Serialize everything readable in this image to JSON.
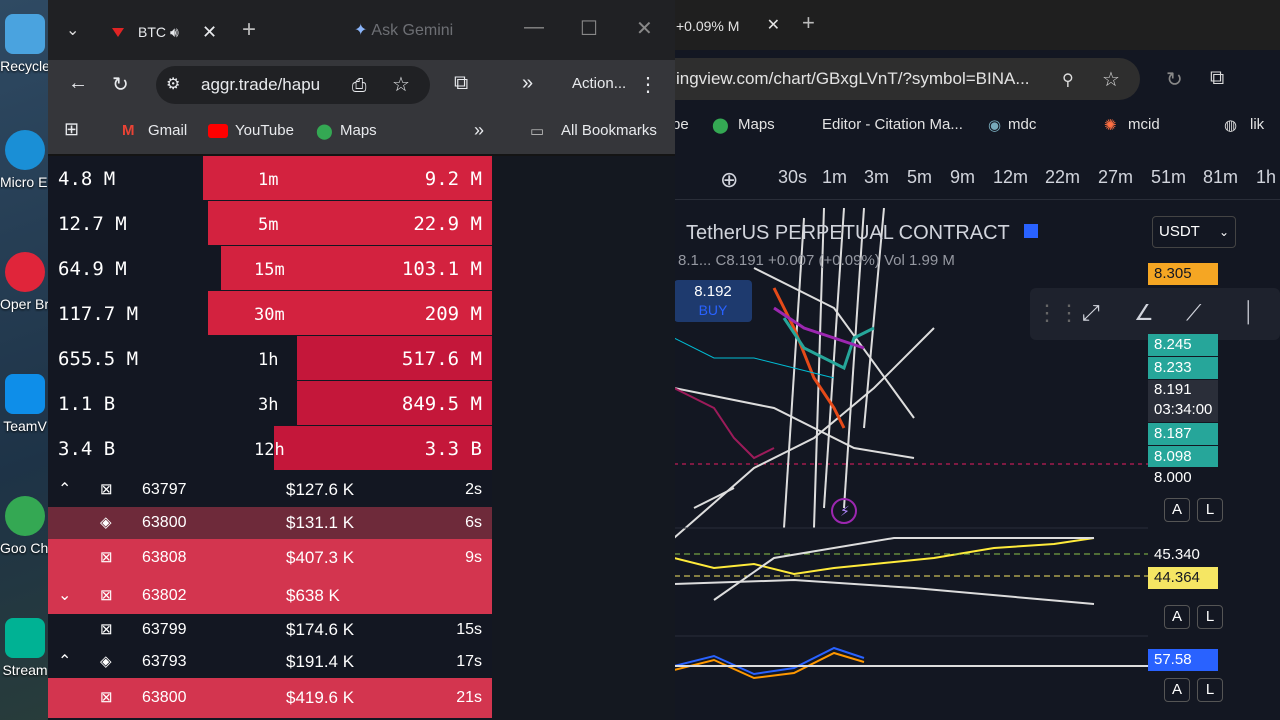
{
  "desktop": {
    "icons": [
      {
        "label": "Recycle",
        "color": "#4aa3df"
      },
      {
        "label": "Micro Edg",
        "color": "#1a8fd6"
      },
      {
        "label": "Oper Brow",
        "color": "#e0253a"
      },
      {
        "label": "TeamV",
        "color": "#0e8ee9"
      },
      {
        "label": "Goo Chro",
        "color": "#34a853"
      },
      {
        "label": "Stream",
        "color": "#00b294"
      }
    ]
  },
  "tradingview": {
    "tab_label": "+0.09% M",
    "url": "ingview.com/chart/GBxgLVnT/?symbol=BINA...",
    "bookmarks": [
      "be",
      "Maps",
      "Editor - Citation Ma...",
      "mdc",
      "mcid",
      "lik"
    ],
    "timeframes": [
      "30s",
      "1m",
      "3m",
      "5m",
      "9m",
      "12m",
      "22m",
      "27m",
      "51m",
      "81m",
      "1h"
    ],
    "title": "TetherUS PERPETUAL CONTRACT",
    "ohlc": "8.1... C8.191  +0.007  (+0.09%)  Vol 1.99 M",
    "buy_price": "8.192",
    "buy_label": "BUY",
    "currency": "USDT",
    "price_labels": [
      {
        "value": "8.305",
        "color": "#f5a623"
      },
      {
        "value": "8.245",
        "color": "#26a69a"
      },
      {
        "value": "8.233",
        "color": "#26a69a"
      },
      {
        "value": "8.191",
        "sub": "03:34:00",
        "color": "#2a2e39"
      },
      {
        "value": "8.187",
        "color": "#26a69a"
      },
      {
        "value": "8.098",
        "color": "#26a69a"
      },
      {
        "value": "8.000",
        "color": "#131722"
      }
    ],
    "indicator_labels": [
      {
        "value": "45.340",
        "color": "#131722"
      },
      {
        "value": "44.364",
        "color": "#f5e663"
      },
      {
        "value": "57.58",
        "color": "#2962ff"
      }
    ],
    "ab_buttons": [
      "A",
      "L"
    ]
  },
  "aggr": {
    "tab_title": "BTC",
    "gemini": "Ask Gemini",
    "url": "aggr.trade/hapu",
    "actions": "Action...",
    "bookmarks": {
      "gmail": "Gmail",
      "youtube": "YouTube",
      "maps": "Maps",
      "all": "All Bookmarks"
    },
    "stats": [
      {
        "left": "4.8 M",
        "tf": "1m",
        "right": "9.2 M",
        "sell_frac": 0.65
      },
      {
        "left": "12.7 M",
        "tf": "5m",
        "right": "22.9 M",
        "sell_frac": 0.64
      },
      {
        "left": "64.9 M",
        "tf": "15m",
        "right": "103.1 M",
        "sell_frac": 0.61
      },
      {
        "left": "117.7 M",
        "tf": "30m",
        "right": "209 M",
        "sell_frac": 0.64
      },
      {
        "left": "655.5 M",
        "tf": "1h",
        "right": "517.6 M",
        "sell_frac": 0.44
      },
      {
        "left": "1.1 B",
        "tf": "3h",
        "right": "849.5 M",
        "sell_frac": 0.44
      },
      {
        "left": "3.4 B",
        "tf": "12h",
        "right": "3.3 B",
        "sell_frac": 0.49
      }
    ],
    "trades": [
      {
        "arrow": "⌃",
        "icon": "binance",
        "price": "63797",
        "amount": "$127.6 K",
        "time": "2s",
        "side": "neutral"
      },
      {
        "arrow": "",
        "icon": "diamond",
        "price": "63800",
        "amount": "$131.1 K",
        "time": "6s",
        "side": "light"
      },
      {
        "arrow": "",
        "icon": "binance",
        "price": "63808",
        "amount": "$407.3 K",
        "time": "9s",
        "side": "sell"
      },
      {
        "arrow": "⌄",
        "icon": "binance",
        "price": "63802",
        "amount": "$638 K",
        "time": "",
        "side": "sell"
      },
      {
        "arrow": "",
        "icon": "binance",
        "price": "63799",
        "amount": "$174.6 K",
        "time": "15s",
        "side": "neutral"
      },
      {
        "arrow": "⌃",
        "icon": "diamond",
        "price": "63793",
        "amount": "$191.4 K",
        "time": "17s",
        "side": "neutral"
      },
      {
        "arrow": "",
        "icon": "binance",
        "price": "63800",
        "amount": "$419.6 K",
        "time": "21s",
        "side": "sell"
      }
    ]
  }
}
